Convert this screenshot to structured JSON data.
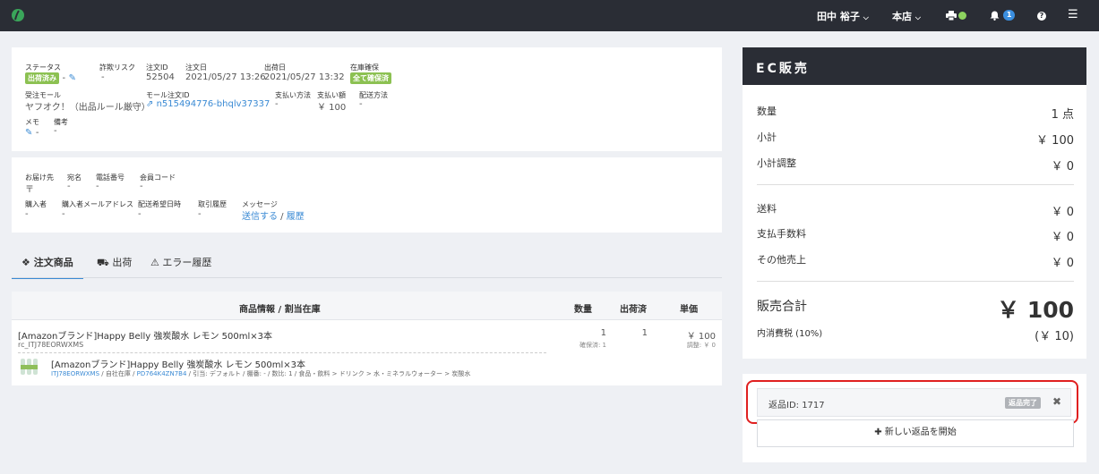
{
  "header": {
    "user": "田中 裕子",
    "store": "本店",
    "notif_count": "1"
  },
  "order": {
    "status_label": "ステータス",
    "status": "出荷済み",
    "status_dash": "-",
    "fraud_label": "詐欺リスク",
    "fraud_value": "-",
    "order_id_label": "注文ID",
    "order_id": "52504",
    "order_date_label": "注文日",
    "order_date": "2021/05/27 13:26",
    "ship_date_label": "出荷日",
    "ship_date": "2021/05/27 13:32",
    "stock_label": "在庫確保",
    "stock": "全て確保済",
    "mall_label": "受注モール",
    "mall": "ヤフオク！（出品ルール厳守）",
    "mall_order_label": "モール注文ID",
    "mall_order_id": "n515494776-bhqlv37337",
    "payment_method_label": "支払い方法",
    "payment_method": "-",
    "payment_amount_label": "支払い額",
    "payment_amount": "￥ 100",
    "ship_method_label": "配送方法",
    "ship_method": "-",
    "memo_label": "メモ",
    "memo": "-",
    "note_label": "備考",
    "note": "-"
  },
  "shipping": {
    "dest_label": "お届け先",
    "dest": "〒",
    "addressee_label": "宛名",
    "addressee": "-",
    "phone_label": "電話番号",
    "phone": "-",
    "member_label": "会員コード",
    "member": "-",
    "buyer_label": "購入者",
    "buyer": "-",
    "buyer_email_label": "購入者メールアドレス",
    "buyer_email": "-",
    "delivery_date_label": "配送希望日時",
    "delivery_date": "-",
    "history_label": "取引履歴",
    "history": "-",
    "message_label": "メッセージ",
    "send": "送信する",
    "sep": " / ",
    "msg_history": "履歴"
  },
  "tabs": [
    {
      "label": "注文商品"
    },
    {
      "label": "出荷"
    },
    {
      "label": "エラー履歴"
    }
  ],
  "table": {
    "headers": [
      "商品情報 / 割当在庫",
      "数量",
      "出荷済",
      "単価"
    ],
    "item_name": "[Amazonブランド]Happy Belly 強炭酸水 レモン 500ml×3本",
    "item_sku": "rc_ITJ78EORWXMS",
    "qty": "1",
    "qty_sub": "確保済: 1",
    "shipped": "1",
    "price": "￥ 100",
    "price_sub": "調整: ￥ 0",
    "stock_name": "[Amazonブランド]Happy Belly 強炭酸水 レモン 500ml×3本",
    "stock_code": "ITJ78EORWXMS",
    "stock_warehouse": " / 自社在庫 / ",
    "stock_code2": "PD764K4ZN7B4",
    "stock_details": " / 引当: デフォルト / 棚番: - / 数比: 1 / 食品・飲料 > ドリンク > 水・ミネラルウォーター > 炭酸水"
  },
  "sales": {
    "title": "EC販売",
    "qty_label": "数量",
    "qty": "1 点",
    "subtotal_label": "小計",
    "subtotal": "￥ 100",
    "adjust_label": "小計調整",
    "adjust": "￥ 0",
    "shipping_label": "送料",
    "shipping": "￥ 0",
    "fee_label": "支払手数料",
    "fee": "￥ 0",
    "other_label": "その他売上",
    "other": "￥ 0",
    "total_label": "販売合計",
    "total": "￥ 100",
    "tax_label": "内消費税 (10%)",
    "tax": "(￥ 10)"
  },
  "returns": {
    "return_id": "返品ID: 1717",
    "return_status": "返品完了",
    "new_return": "新しい返品を開始"
  },
  "colors": {
    "topbar": "#2a2d35",
    "accent": "#3a8ad4",
    "green": "#8cc152",
    "highlight": "#e02020"
  }
}
